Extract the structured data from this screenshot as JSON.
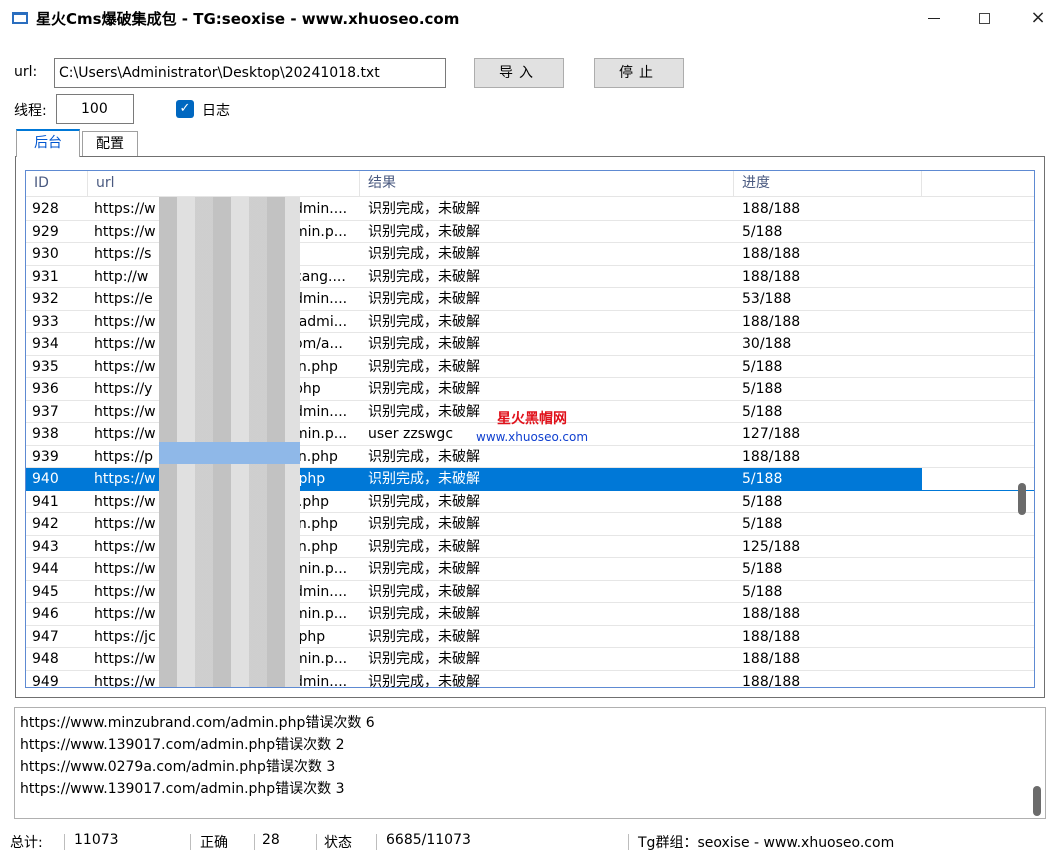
{
  "window": {
    "title": "星火Cms爆破集成包 - TG:seoxise - www.xhuoseo.com",
    "min_symbol": "",
    "close_symbol": "×"
  },
  "form": {
    "url_label": "url:",
    "url_value": "C:\\Users\\Administrator\\Desktop\\20241018.txt",
    "import_label": "导入",
    "stop_label": "停止",
    "thread_label": "线程:",
    "thread_value": "100",
    "log_checked": true,
    "log_label": "日志"
  },
  "tabs": [
    {
      "label": "后台",
      "active": true
    },
    {
      "label": "配置",
      "active": false
    }
  ],
  "table": {
    "columns": [
      "ID",
      "url",
      "结果",
      "进度"
    ],
    "selected_id": "940",
    "rows": [
      {
        "id": "928",
        "url_start": "https://w",
        "url_end": "dmin....",
        "result": "识别完成，未破解",
        "progress": "188/188"
      },
      {
        "id": "929",
        "url_start": "https://w",
        "url_end": "min.p...",
        "result": "识别完成，未破解",
        "progress": "5/188"
      },
      {
        "id": "930",
        "url_start": "https://s",
        "url_end": "",
        "result": "识别完成，未破解",
        "progress": "188/188"
      },
      {
        "id": "931",
        "url_start": "http://w",
        "url_end": "cang....",
        "result": "识别完成，未破解",
        "progress": "188/188"
      },
      {
        "id": "932",
        "url_start": "https://e",
        "url_end": "dmin....",
        "result": "识别完成，未破解",
        "progress": "53/188"
      },
      {
        "id": "933",
        "url_start": "https://w",
        "url_end": "/admi...",
        "result": "识别完成，未破解",
        "progress": "188/188"
      },
      {
        "id": "934",
        "url_start": "https://w",
        "url_end": "om/a...",
        "result": "识别完成，未破解",
        "progress": "30/188"
      },
      {
        "id": "935",
        "url_start": "https://w",
        "url_end": "in.php",
        "result": "识别完成，未破解",
        "progress": "5/188"
      },
      {
        "id": "936",
        "url_start": "https://y",
        "url_end": "php",
        "result": "识别完成，未破解",
        "progress": "5/188"
      },
      {
        "id": "937",
        "url_start": "https://w",
        "url_end": "dmin....",
        "result": "识别完成，未破解",
        "progress": "5/188"
      },
      {
        "id": "938",
        "url_start": "https://w",
        "url_end": "min.p...",
        "result": "user   zzswgc",
        "progress": "127/188"
      },
      {
        "id": "939",
        "url_start": "https://p",
        "url_end": "in.php",
        "result": "识别完成，未破解",
        "progress": "188/188"
      },
      {
        "id": "940",
        "url_start": "https://w",
        "url_end": ".php",
        "result": "识别完成，未破解",
        "progress": "5/188"
      },
      {
        "id": "941",
        "url_start": "https://w",
        "url_end": "i.php",
        "result": "识别完成，未破解",
        "progress": "5/188"
      },
      {
        "id": "942",
        "url_start": "https://w",
        "url_end": "in.php",
        "result": "识别完成，未破解",
        "progress": "5/188"
      },
      {
        "id": "943",
        "url_start": "https://w",
        "url_end": "in.php",
        "result": "识别完成，未破解",
        "progress": "125/188"
      },
      {
        "id": "944",
        "url_start": "https://w",
        "url_end": "min.p...",
        "result": "识别完成，未破解",
        "progress": "5/188"
      },
      {
        "id": "945",
        "url_start": "https://w",
        "url_end": "dmin....",
        "result": "识别完成，未破解",
        "progress": "5/188"
      },
      {
        "id": "946",
        "url_start": "https://w",
        "url_end": "min.p...",
        "result": "识别完成，未破解",
        "progress": "188/188"
      },
      {
        "id": "947",
        "url_start": "https://jc",
        "url_end": ".php",
        "result": "识别完成，未破解",
        "progress": "188/188"
      },
      {
        "id": "948",
        "url_start": "https://w",
        "url_end": "min.p...",
        "result": "识别完成，未破解",
        "progress": "188/188"
      },
      {
        "id": "949",
        "url_start": "https://w",
        "url_end": "dmin....",
        "result": "识别完成，未破解",
        "progress": "188/188"
      }
    ]
  },
  "watermark": {
    "line1": "星火黑帽网",
    "line2": "www.xhuoseo.com"
  },
  "log": [
    "https://www.minzubrand.com/admin.php错误次数  6",
    "https://www.139017.com/admin.php错误次数  2",
    "https://www.0279a.com/admin.php错误次数  3",
    "https://www.139017.com/admin.php错误次数  3"
  ],
  "status": {
    "total_label": "总计:",
    "total_value": "11073",
    "correct_label": "正确",
    "correct_value": "28",
    "state_label": "状态",
    "state_value": "6685/11073",
    "tg_text": "Tg群组：seoxise - www.xhuoseo.com"
  },
  "colors": {
    "accent": "#0078d7",
    "checkbox": "#0067c0",
    "watermark_red": "#e0101a",
    "watermark_blue": "#1040d0"
  }
}
